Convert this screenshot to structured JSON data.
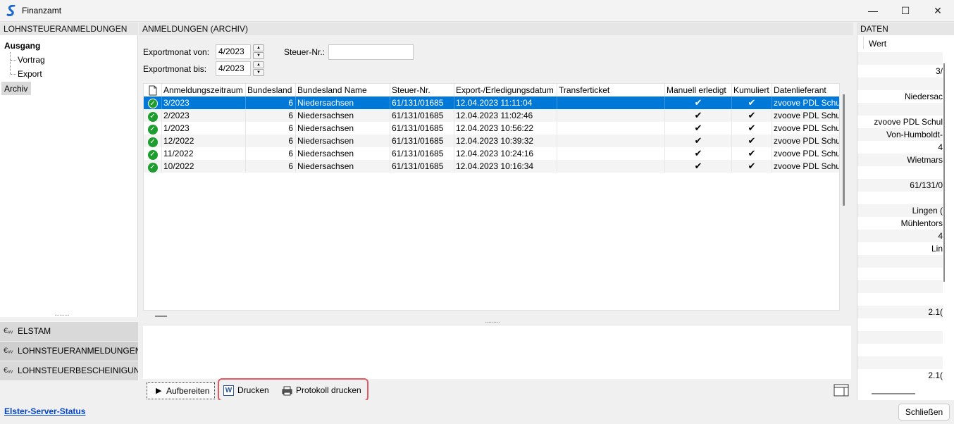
{
  "window": {
    "title": "Finanzamt",
    "minimize_glyph": "—",
    "maximize_glyph": "☐",
    "close_glyph": "✕"
  },
  "left": {
    "header": "LOHNSTEUERANMELDUNGEN",
    "tree": {
      "ausgang": "Ausgang",
      "vortrag": "Vortrag",
      "export": "Export",
      "archiv": "Archiv"
    },
    "nav": [
      "ELSTAM",
      "LOHNSTEUERANMELDUNGEN",
      "LOHNSTEUERBESCHEINIGUNGEN"
    ]
  },
  "main": {
    "header": "ANMELDUNGEN (ARCHIV)",
    "export_von_label": "Exportmonat von:",
    "export_von_value": "4/2023",
    "export_bis_label": "Exportmonat bis:",
    "export_bis_value": "4/2023",
    "steuer_label": "Steuer-Nr.:",
    "steuer_value": "",
    "columns": [
      "Anmeldungszeitraum",
      "Bundesland",
      "Bundesland Name",
      "Steuer-Nr.",
      "Export-/Erledigungsdatum",
      "Transferticket",
      "Manuell erledigt",
      "Kumuliert",
      "Datenlieferant"
    ],
    "rows": [
      {
        "zeitraum": "3/2023",
        "bundesland": "6",
        "name": "Niedersachsen",
        "steuer": "61/131/01685",
        "datum": "12.04.2023 11:11:04",
        "ticket": "",
        "manuell": "✔",
        "kumuliert": "✔",
        "lieferant": "zvoove PDL Schul"
      },
      {
        "zeitraum": "2/2023",
        "bundesland": "6",
        "name": "Niedersachsen",
        "steuer": "61/131/01685",
        "datum": "12.04.2023 11:02:46",
        "ticket": "",
        "manuell": "✔",
        "kumuliert": "✔",
        "lieferant": "zvoove PDL Schul"
      },
      {
        "zeitraum": "1/2023",
        "bundesland": "6",
        "name": "Niedersachsen",
        "steuer": "61/131/01685",
        "datum": "12.04.2023 10:56:22",
        "ticket": "",
        "manuell": "✔",
        "kumuliert": "✔",
        "lieferant": "zvoove PDL Schul"
      },
      {
        "zeitraum": "12/2022",
        "bundesland": "6",
        "name": "Niedersachsen",
        "steuer": "61/131/01685",
        "datum": "12.04.2023 10:39:32",
        "ticket": "",
        "manuell": "✔",
        "kumuliert": "✔",
        "lieferant": "zvoove PDL Schul"
      },
      {
        "zeitraum": "11/2022",
        "bundesland": "6",
        "name": "Niedersachsen",
        "steuer": "61/131/01685",
        "datum": "12.04.2023 10:24:16",
        "ticket": "",
        "manuell": "✔",
        "kumuliert": "✔",
        "lieferant": "zvoove PDL Schul"
      },
      {
        "zeitraum": "10/2022",
        "bundesland": "6",
        "name": "Niedersachsen",
        "steuer": "61/131/01685",
        "datum": "12.04.2023 10:16:34",
        "ticket": "",
        "manuell": "✔",
        "kumuliert": "✔",
        "lieferant": "zvoove PDL Schul"
      }
    ],
    "buttons": {
      "aufbereiten": "Aufbereiten",
      "drucken": "Drucken",
      "protokoll": "Protokoll drucken"
    }
  },
  "right": {
    "header": "DATEN",
    "column": "Wert",
    "values": [
      "",
      "3/",
      "",
      "Niedersac",
      "",
      "zvoove PDL Schul",
      "Von-Humboldt-",
      "4",
      "Wietmars",
      "",
      "61/131/0",
      "",
      "Lingen (",
      "Mühlentors",
      "4",
      "Lin",
      "",
      "",
      "",
      "",
      "2.1(",
      "",
      "",
      "",
      "",
      "2.1("
    ]
  },
  "status": {
    "link": "Elster-Server-Status",
    "close": "Schließen"
  }
}
